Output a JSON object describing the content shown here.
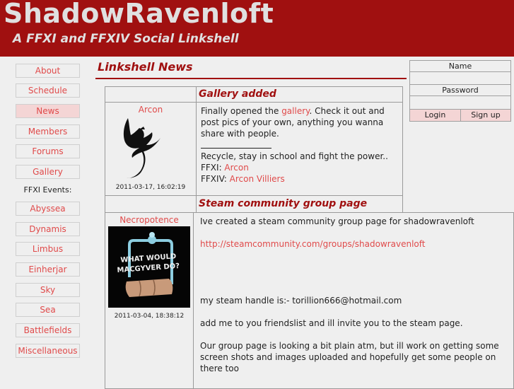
{
  "header": {
    "title": "ShadowRavenloft",
    "subtitle": "A FFXI and FFXIV Social Linkshell"
  },
  "sidebar": {
    "items": [
      {
        "label": "About",
        "active": false
      },
      {
        "label": "Schedule",
        "active": false
      },
      {
        "label": "News",
        "active": true
      },
      {
        "label": "Members",
        "active": false
      },
      {
        "label": "Forums",
        "active": false
      },
      {
        "label": "Gallery",
        "active": false
      }
    ],
    "events_label": "FFXI Events:",
    "events": [
      {
        "label": "Abyssea"
      },
      {
        "label": "Dynamis"
      },
      {
        "label": "Limbus"
      },
      {
        "label": "Einherjar"
      },
      {
        "label": "Sky"
      },
      {
        "label": "Sea"
      },
      {
        "label": "Battlefields"
      },
      {
        "label": "Miscellaneous"
      }
    ]
  },
  "main": {
    "title": "Linkshell News",
    "posts": [
      {
        "title": "Gallery added",
        "author": "Arcon",
        "avatar_icon": "raven-silhouette-icon",
        "timestamp": "2011-03-17, 16:02:19",
        "body": {
          "line1_pre": "Finally opened the ",
          "line1_link": "gallery",
          "line1_post": ". Check it out and",
          "line2": "post pics of your own, anything you wanna",
          "line3": "share with people.",
          "signature_rule": "________________",
          "sig_line1": "Recycle, stay in school and fight the power..",
          "sig_ffxi_label": "FFXI: ",
          "sig_ffxi_name": "Arcon",
          "sig_ffxiv_label": "FFXIV: ",
          "sig_ffxiv_name": "Arcon Villiers"
        }
      },
      {
        "title": "Steam community group page",
        "author": "Necropotence",
        "avatar_icon": "macgyver-toilet-paper-icon",
        "avatar_text": [
          "WHAT WOULD",
          "MACGYVER DO?"
        ],
        "timestamp": "2011-03-04, 18:38:12",
        "body": {
          "p1": "Ive created a steam community group page for shadowravenloft",
          "link": "http://steamcommunity.com/groups/shadowravenloft",
          "p2": "my steam handle is:- torillion666@hotmail.com",
          "p3": "add me to you friendslist and ill invite you to the steam page.",
          "p4_l1": "Our group page is looking a bit plain atm, but ill work on getting some",
          "p4_l2": "screen shots and images uploaded and hopefully get some people on",
          "p4_l3": "there too"
        }
      }
    ]
  },
  "login": {
    "name_label": "Name",
    "name_value": "",
    "password_label": "Password",
    "password_value": "",
    "login_label": "Login",
    "signup_label": "Sign up"
  },
  "colors": {
    "brand": "#a01010",
    "link": "#e04a4a",
    "background": "#efefef",
    "active_highlight": "#f4d5d5"
  }
}
